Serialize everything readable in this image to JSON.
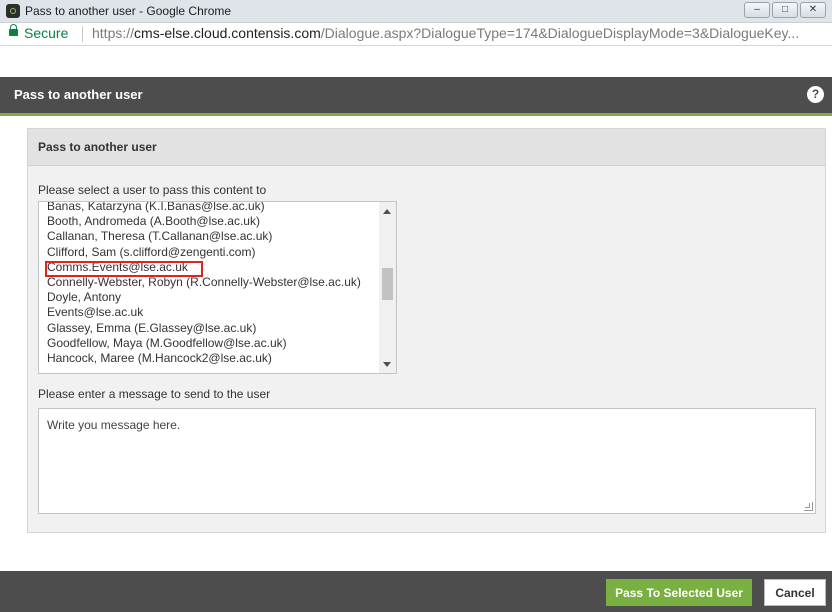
{
  "window": {
    "title": "Pass to another user - Google Chrome",
    "controls": {
      "minimize": "–",
      "maximize": "□",
      "close": "✕"
    }
  },
  "address_bar": {
    "secure_label": "Secure",
    "url_scheme": "https://",
    "url_host": "cms-else.cloud.contensis.com",
    "url_path": "/Dialogue.aspx?DialogueType=174&DialogueDisplayMode=3&DialogueKey..."
  },
  "dialog": {
    "header_title": "Pass to another user",
    "help_icon": "?",
    "panel_title": "Pass to another user",
    "select_label": "Please select a user to pass this content to",
    "users": [
      "Banas, Katarzyna (K.I.Banas@lse.ac.uk)",
      "Booth, Andromeda (A.Booth@lse.ac.uk)",
      "Callanan, Theresa (T.Callanan@lse.ac.uk)",
      "Clifford, Sam (s.clifford@zengenti.com)",
      "Comms.Events@lse.ac.uk",
      "Connelly-Webster, Robyn (R.Connelly-Webster@lse.ac.uk)",
      "Doyle, Antony",
      "Events@lse.ac.uk",
      "Glassey, Emma (E.Glassey@lse.ac.uk)",
      "Goodfellow, Maya (M.Goodfellow@lse.ac.uk)",
      "Hancock, Maree (M.Hancock2@lse.ac.uk)"
    ],
    "highlighted_user": "Comms.Events@lse.ac.uk",
    "message_label": "Please enter a message to send to the user",
    "message_placeholder": "Write you message here."
  },
  "footer": {
    "pass_button": "Pass To Selected User",
    "cancel_button": "Cancel"
  },
  "colors": {
    "header_bg": "#4d4d4d",
    "accent_green": "#7aaf42",
    "secure_green": "#0b8043",
    "highlight_red": "#e0241b"
  }
}
